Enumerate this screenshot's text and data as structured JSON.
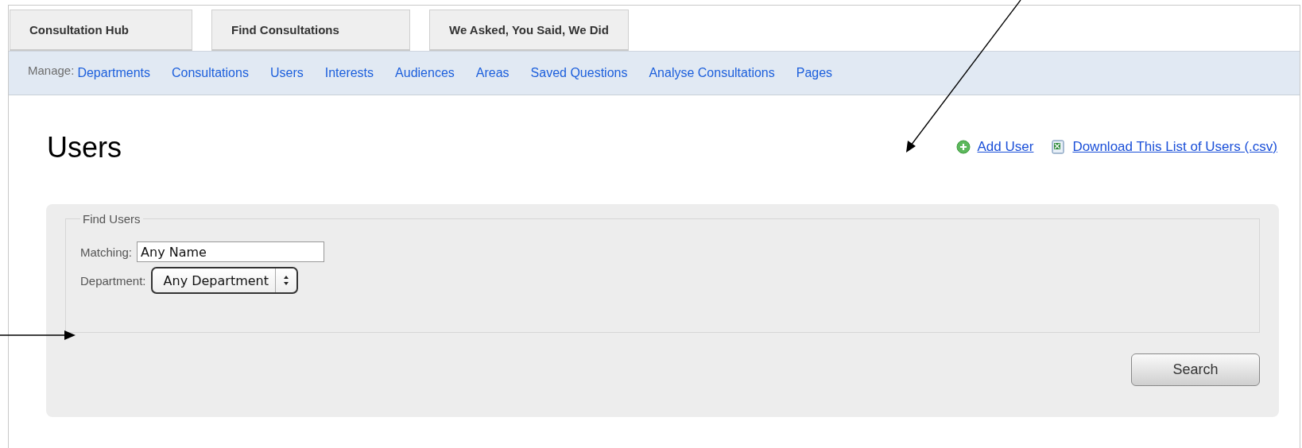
{
  "tabs": [
    {
      "label": "Consultation Hub",
      "selected": false
    },
    {
      "label": "Find Consultations",
      "selected": false
    },
    {
      "label": "We Asked, You Said, We Did",
      "selected": false
    }
  ],
  "manage": {
    "label": "Manage:",
    "links": [
      "Departments",
      "Consultations",
      "Users",
      "Interests",
      "Audiences",
      "Areas",
      "Saved Questions",
      "Analyse Consultations",
      "Pages"
    ]
  },
  "page_title": "Users",
  "actions": [
    {
      "kind": "add",
      "label": "Add User"
    },
    {
      "kind": "download",
      "label": "Download This List of Users (.csv)"
    }
  ],
  "find_users": {
    "legend": "Find Users",
    "matching_label": "Matching:",
    "matching_value": "Any Name",
    "department_label": "Department:",
    "department_value": "Any Department",
    "search_button": "Search"
  }
}
